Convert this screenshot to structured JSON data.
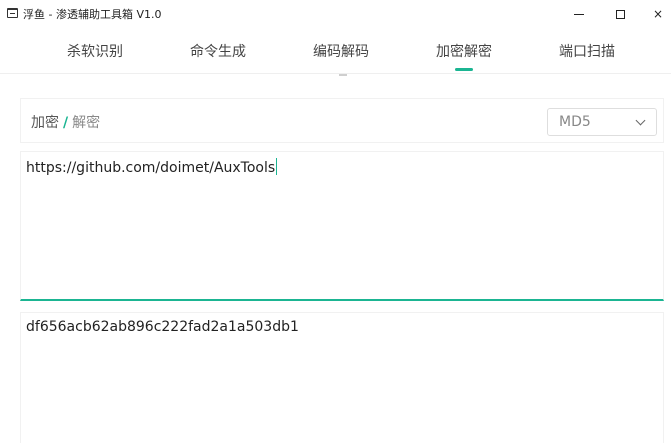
{
  "window": {
    "title": "浮鱼 - 渗透辅助工具箱 V1.0",
    "icon": "app-window-icon",
    "controls": {
      "minimize": "minimize-icon",
      "maximize": "maximize-icon",
      "close": "×"
    }
  },
  "tabs": [
    {
      "label": "杀软识别"
    },
    {
      "label": "命令生成"
    },
    {
      "label": "编码解码"
    },
    {
      "label": "加密解密",
      "active": true
    },
    {
      "label": "端口扫描"
    }
  ],
  "accent_color": "#1bb592",
  "mode": {
    "encrypt_label": "加密",
    "separator": "/",
    "decrypt_label": "解密",
    "selected": "encrypt"
  },
  "algorithm": {
    "selected": "MD5",
    "icon": "chevron-down-icon"
  },
  "input": {
    "value": "https://github.com/doimet/AuxTools"
  },
  "output": {
    "value": "df656acb62ab896c222fad2a1a503db1"
  }
}
